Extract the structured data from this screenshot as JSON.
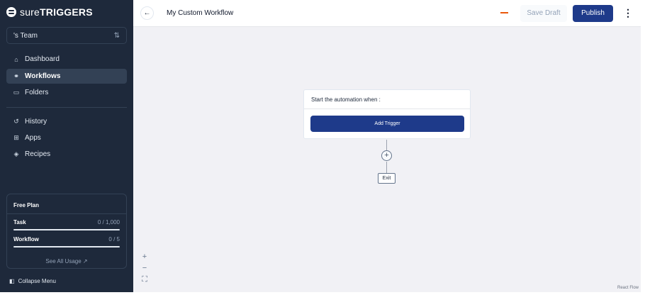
{
  "brand": {
    "logo_thin": "sure",
    "logo_bold": "TRIGGERS"
  },
  "team": {
    "name": "'s Team"
  },
  "nav": {
    "group1": [
      {
        "label": "Dashboard",
        "icon": "home-icon",
        "glyph": "⌂"
      },
      {
        "label": "Workflows",
        "icon": "workflow-icon",
        "glyph": "⚭",
        "active": true
      },
      {
        "label": "Folders",
        "icon": "folder-icon",
        "glyph": "▭"
      }
    ],
    "group2": [
      {
        "label": "History",
        "icon": "history-icon",
        "glyph": "↺"
      },
      {
        "label": "Apps",
        "icon": "apps-grid-icon",
        "glyph": "⊞"
      },
      {
        "label": "Recipes",
        "icon": "layers-icon",
        "glyph": "◈"
      }
    ]
  },
  "plan": {
    "title": "Free Plan",
    "task_label": "Task",
    "task_value": "0 / 1,000",
    "task_used": 0,
    "workflow_label": "Workflow",
    "workflow_value": "0 / 5",
    "workflow_used": 0,
    "usage_link": "See All Usage ↗"
  },
  "collapse_label": "Collapse Menu",
  "header": {
    "title": "My Custom Workflow",
    "save_draft": "Save Draft",
    "publish": "Publish"
  },
  "canvas": {
    "trigger_prompt": "Start the automation when :",
    "add_trigger": "Add Trigger",
    "exit_label": "Exit",
    "attribution": "React Flow"
  },
  "colors": {
    "sidebar_bg": "#1e293b",
    "primary": "#1e3a8a",
    "status_unsaved": "#ea580c",
    "canvas_bg": "#f1f1f5"
  }
}
